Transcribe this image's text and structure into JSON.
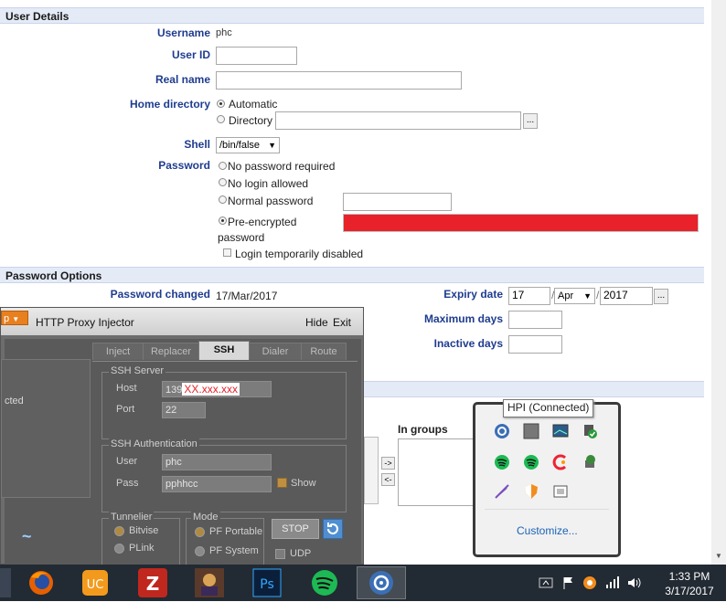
{
  "user_details": {
    "header": "User Details",
    "username_label": "Username",
    "username_value": "phc",
    "userid_label": "User ID",
    "realname_label": "Real name",
    "homedir_label": "Home directory",
    "homedir_auto": "Automatic",
    "homedir_dir": "Directory",
    "browse": "...",
    "shell_label": "Shell",
    "shell_value": "/bin/false",
    "password_label": "Password",
    "pw_none": "No password required",
    "pw_nologin": "No login allowed",
    "pw_normal": "Normal password",
    "pw_pre_line1": "Pre-encrypted",
    "pw_pre_line2": "password",
    "pw_disabled": "Login temporarily disabled"
  },
  "password_options": {
    "header": "Password Options",
    "changed_label": "Password changed",
    "changed_value": "17/Mar/2017",
    "expiry_label": "Expiry date",
    "expiry_day": "17",
    "expiry_month": "Apr",
    "expiry_year": "2017",
    "browse": "...",
    "maxdays_label": "Maximum days",
    "inactive_label": "Inactive days"
  },
  "groups": {
    "in_groups_label": "In groups",
    "add_btn": "->",
    "remove_btn": "<-"
  },
  "proxy": {
    "menu_btn": "p",
    "title": "HTTP Proxy Injector",
    "hide": "Hide",
    "exit": "Exit",
    "side_status": "cted",
    "tabs": [
      "Inject",
      "Replacer",
      "SSH",
      "Dialer",
      "Route"
    ],
    "ssh_server": "SSH Server",
    "host_label": "Host",
    "host_prefix": "139",
    "host_masked": "XX.xxx.xxx",
    "port_label": "Port",
    "port_value": "22",
    "ssh_auth": "SSH Authentication",
    "user_label": "User",
    "user_value": "phc",
    "pass_label": "Pass",
    "pass_value": "pphhcc",
    "show_label": "Show",
    "tunneler": "Tunnelier",
    "bitvise": "Bitvise",
    "plink": "PLink",
    "mode": "Mode",
    "pf_portable": "PF Portable",
    "pf_system": "PF System",
    "stop": "STOP",
    "udp": "UDP"
  },
  "tray": {
    "tooltip": "HPI (Connected)",
    "customize": "Customize...",
    "icons": [
      "hpi-icon",
      "window-icon",
      "monitor-icon",
      "shield-check-icon",
      "spotify-icon",
      "spotify-icon-2",
      "ccleaner-icon",
      "network-icon",
      "feather-icon",
      "avast-shield-icon",
      "display-icon"
    ]
  },
  "taskbar": {
    "apps": [
      "firefox-icon",
      "uc-browser-icon",
      "game-z-icon",
      "game-warrior-icon",
      "photoshop-icon",
      "spotify-icon",
      "hpi-icon"
    ],
    "time": "1:33 PM",
    "date": "3/17/2017"
  }
}
